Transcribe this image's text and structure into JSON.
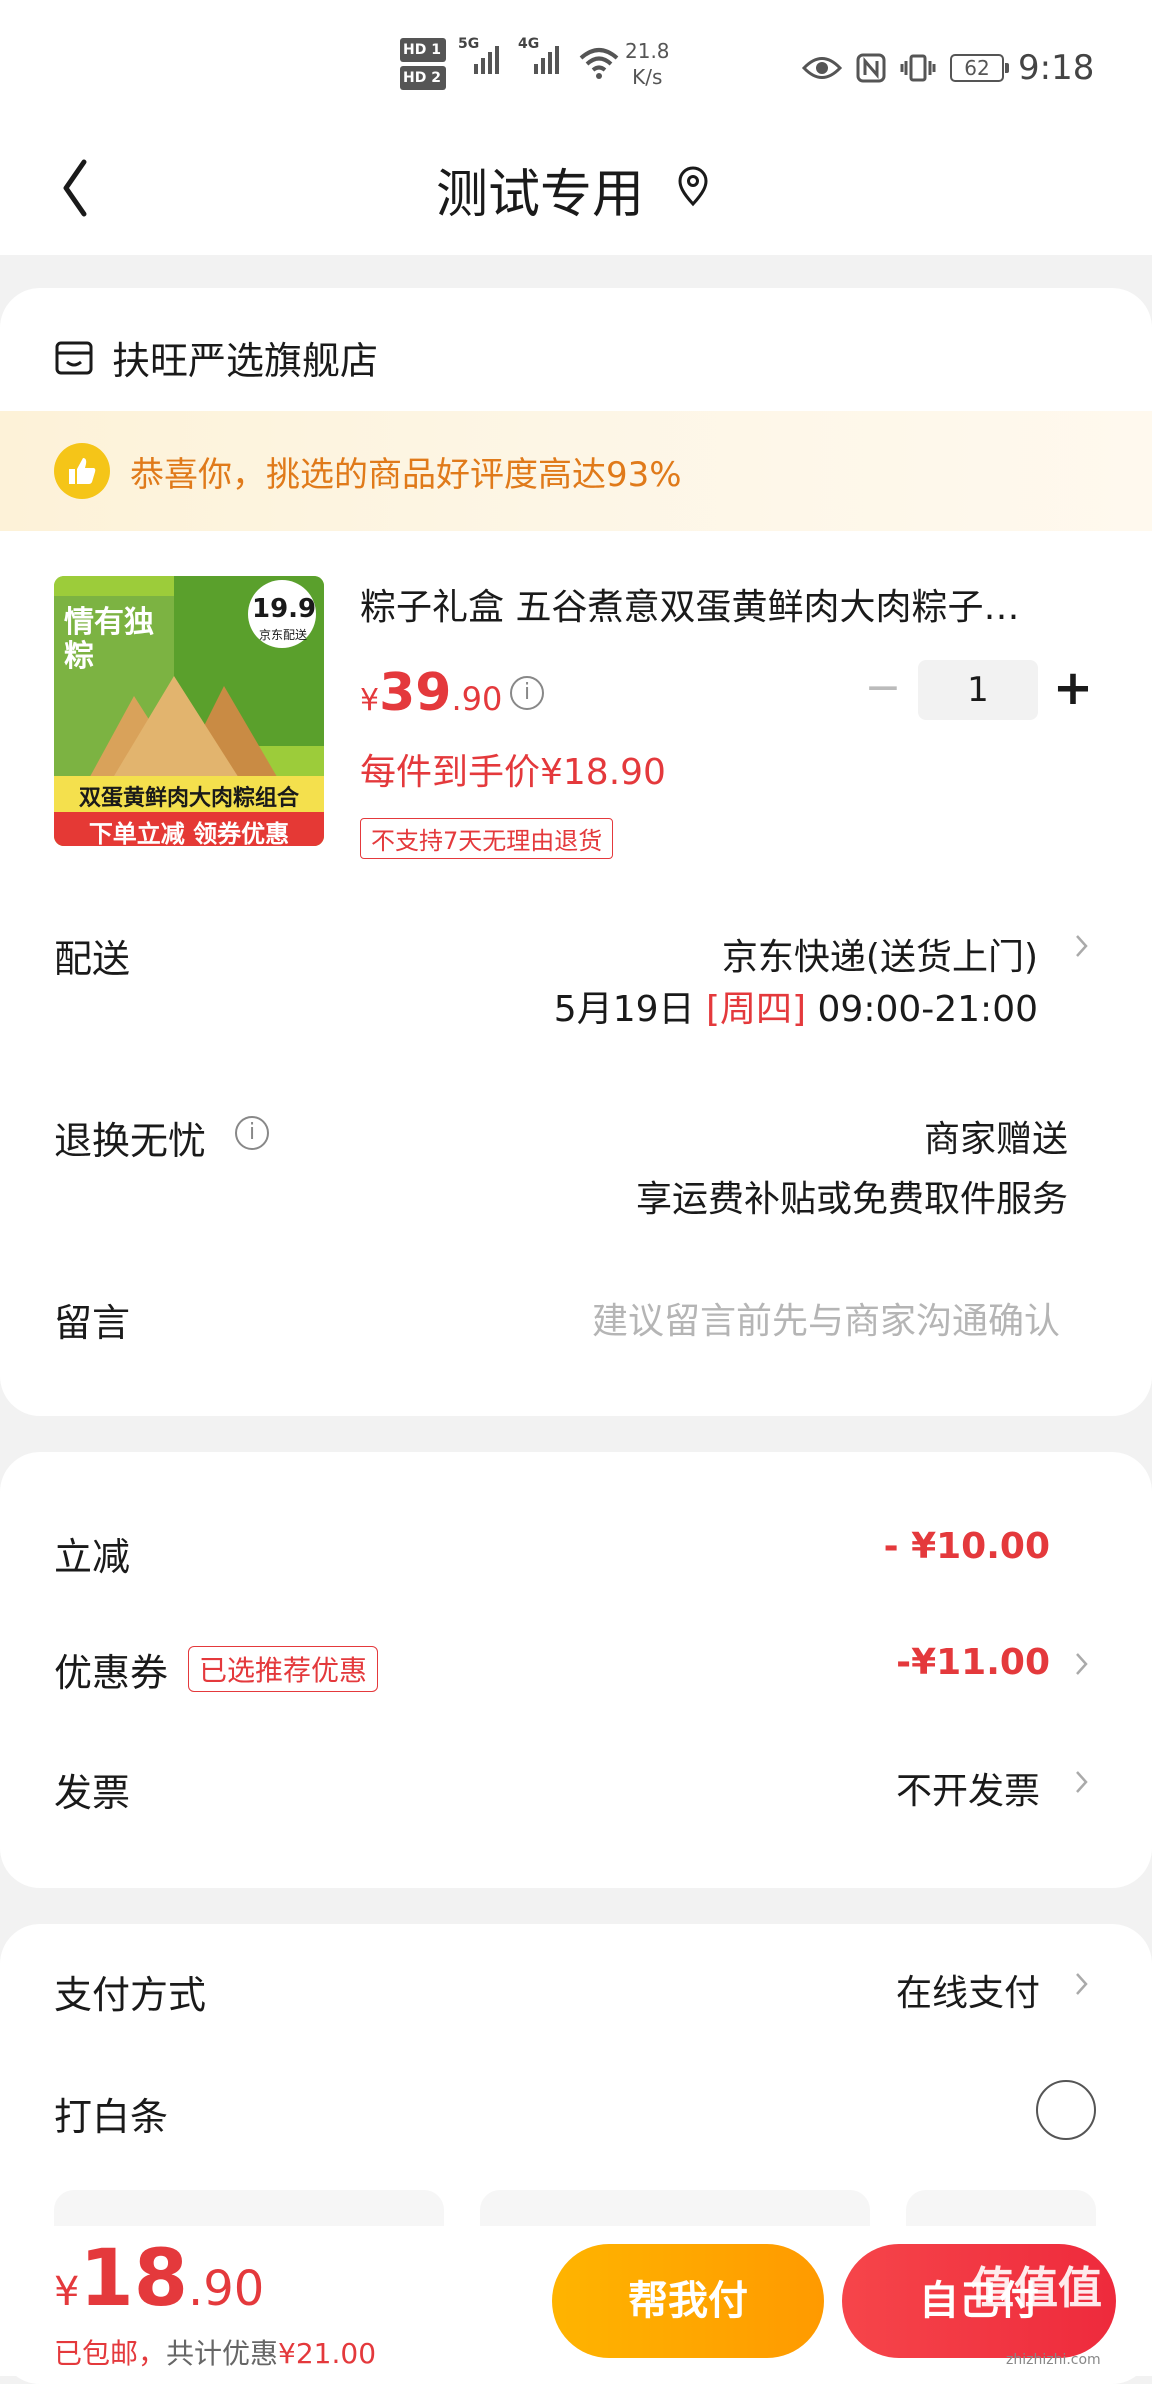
{
  "status_bar": {
    "hd1": "HD 1",
    "hd2": "HD 2",
    "net1": "5G",
    "net2": "4G",
    "speed_value": "21.8",
    "speed_unit": "K/s",
    "battery": "62",
    "time": "9:18"
  },
  "header": {
    "title": "测试专用"
  },
  "store": {
    "name": "扶旺严选旗舰店",
    "banner": "恭喜你，挑选的商品好评度高达93%"
  },
  "product": {
    "title": "粽子礼盒 五谷煮意双蛋黄鲜肉大肉粽子…",
    "currency": "¥",
    "price_int": "39",
    "price_dec": ".90",
    "quantity": "1",
    "unit_price": "每件到手价¥18.90",
    "no_return_tag": "不支持7天无理由退货",
    "image_text": {
      "brand": "情有独粽",
      "badge_price": "19.9",
      "badge_sub": "京东配送",
      "line1": "双蛋黄鲜肉大肉粽组合",
      "line2": "下单立减 领券优惠"
    }
  },
  "delivery": {
    "label": "配送",
    "method": "京东快递(送货上门)",
    "date": "5月19日",
    "weekday": "[周四]",
    "time_window": "09:00-21:00"
  },
  "return": {
    "label": "退换无忧",
    "line1": "商家赠送",
    "line2": "享运费补贴或免费取件服务"
  },
  "message": {
    "label": "留言",
    "placeholder": "建议留言前先与商家沟通确认"
  },
  "discounts": {
    "instant_label": "立减",
    "instant_value": "- ¥10.00",
    "coupon_label": "优惠券",
    "coupon_tag": "已选推荐优惠",
    "coupon_value": "-¥11.00",
    "invoice_label": "发票",
    "invoice_value": "不开发票"
  },
  "payment": {
    "method_label": "支付方式",
    "method_value": "在线支付",
    "baitiao_label": "打白条"
  },
  "bottom": {
    "currency": "¥",
    "total_int": "18",
    "total_dec": ".90",
    "shipping_note": "已包邮，",
    "savings_prefix": "共计优惠",
    "savings_value": "¥21.00",
    "help_pay_label": "帮我付",
    "self_pay_label": "自己付",
    "watermark": "值值值",
    "watermark_url": "zhizhizhi.com"
  },
  "colors": {
    "accent_red": "#e4393c",
    "accent_orange": "#ff9a00",
    "banner_text": "#e07a1a"
  }
}
